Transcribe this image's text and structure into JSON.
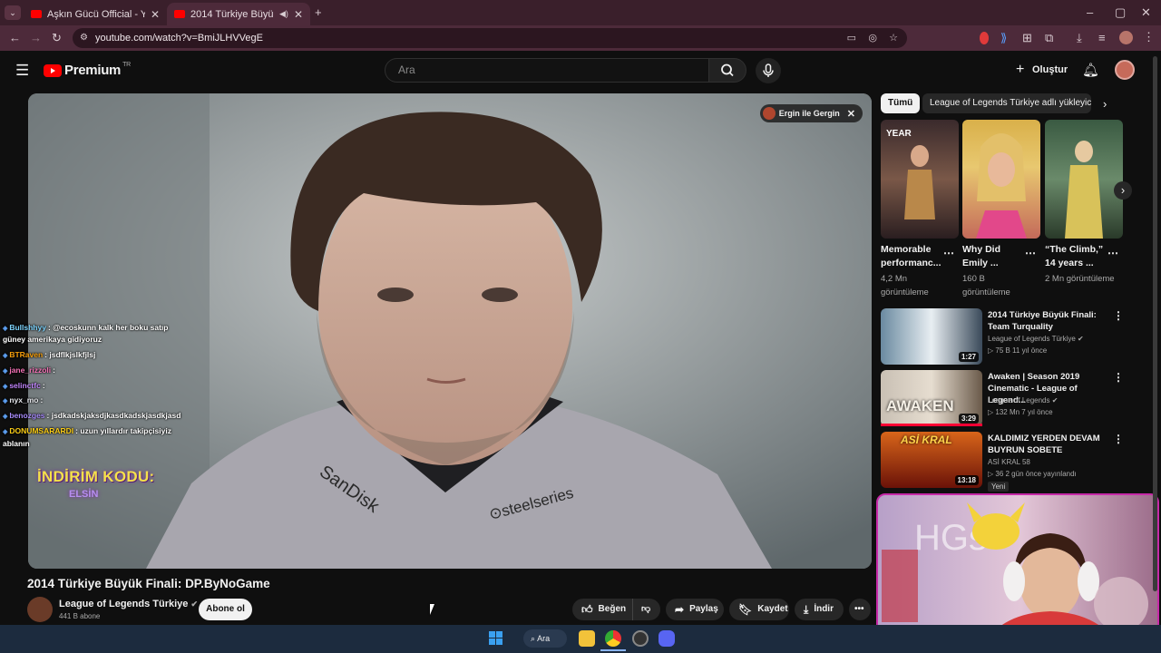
{
  "browser": {
    "tabs": [
      {
        "title": "Aşkın Gücü Official - YouTube",
        "active": false
      },
      {
        "title": "2014 Türkiye Büyük Finali: D",
        "active": true
      }
    ],
    "new_tab_icon": "plus-icon",
    "url": "youtube.com/watch?v=BmiJLHVVegE"
  },
  "yt_header": {
    "logo_text": "Premium",
    "logo_region": "TR",
    "search_placeholder": "Ara",
    "create_label": "Oluştur"
  },
  "video": {
    "channel_chip": "Ergin ile Gergin",
    "title": "2014 Türkiye Büyük Finali: DP.ByNoGame"
  },
  "chat": [
    {
      "user": "Bullshhyy",
      "user_color": "#7dd3fc",
      "msg": ": @ecoskunn kalk her boku satıp"
    },
    {
      "user": "",
      "user_color": "#ffffff",
      "msg": "güney amerikaya gidiyoruz"
    },
    {
      "user": "BTRaven",
      "user_color": "#f59e0b",
      "msg": ": jsdflkjslkfjlsj"
    },
    {
      "user": "jane_rizzoli",
      "user_color": "#f472b6",
      "msg": ":"
    },
    {
      "user": "selinctfc",
      "user_color": "#c084fc",
      "msg": ":"
    },
    {
      "user": "nyx_mo",
      "user_color": "#e5e7eb",
      "msg": ":"
    },
    {
      "user": "benozges",
      "user_color": "#a78bfa",
      "msg": ": jsdkadskjaksdjkasdkadskjasdkjasd"
    },
    {
      "user": "DONUMSARARDI",
      "user_color": "#facc15",
      "msg": ": uzun yıllardır takipçisiyiz"
    },
    {
      "user": "",
      "user_color": "#ffffff",
      "msg": "ablanın"
    }
  ],
  "promo": {
    "line1": "İNDİRİM KODU:",
    "line2": "ELSİN"
  },
  "channel": {
    "name": "League of Legends Türkiye",
    "subs": "441 B abone",
    "subscribe_label": "Abone ol"
  },
  "actions": {
    "like": "Beğen",
    "share": "Paylaş",
    "save": "Kaydet",
    "download": "İndir"
  },
  "sidebar": {
    "chips": [
      "Tümü",
      "League of Legends Türkiye adlı yükleyiciden"
    ],
    "shorts": [
      {
        "title": "Memorable performanc...",
        "views": "4,2 Mn görüntüleme"
      },
      {
        "title": "Why Did Emily ...",
        "views": "160 B görüntüleme"
      },
      {
        "title": "“The Climb,” 14 years ...",
        "views": "2 Mn görüntüleme"
      }
    ],
    "related": [
      {
        "title": "2014 Türkiye Büyük Finali: Team Turquality",
        "channel": "League of Legends Türkiye",
        "meta": "▷ 75 B  11 yıl önce",
        "duration": "1:27",
        "thumb": "#4a6680"
      },
      {
        "title": "Awaken | Season 2019 Cinematic - League of Legend...",
        "channel": "League of Legends",
        "meta": "▷ 132 Mn  7 yıl önce",
        "duration": "3:29",
        "thumb": "#9aa0a6"
      },
      {
        "title": "KALDIMIZ YERDEN DEVAM BUYRUN SOBETE",
        "channel": "ASİ KRAL 58",
        "meta": "▷ 36  2 gün önce yayınlandı",
        "duration": "13:18",
        "thumb": "#8a1e14",
        "badge": "Yeni"
      }
    ],
    "related_thumb_texts": [
      "",
      "AWAKEN",
      "ASİ KRAL"
    ]
  },
  "taskbar": {
    "search_label": "Ara"
  }
}
